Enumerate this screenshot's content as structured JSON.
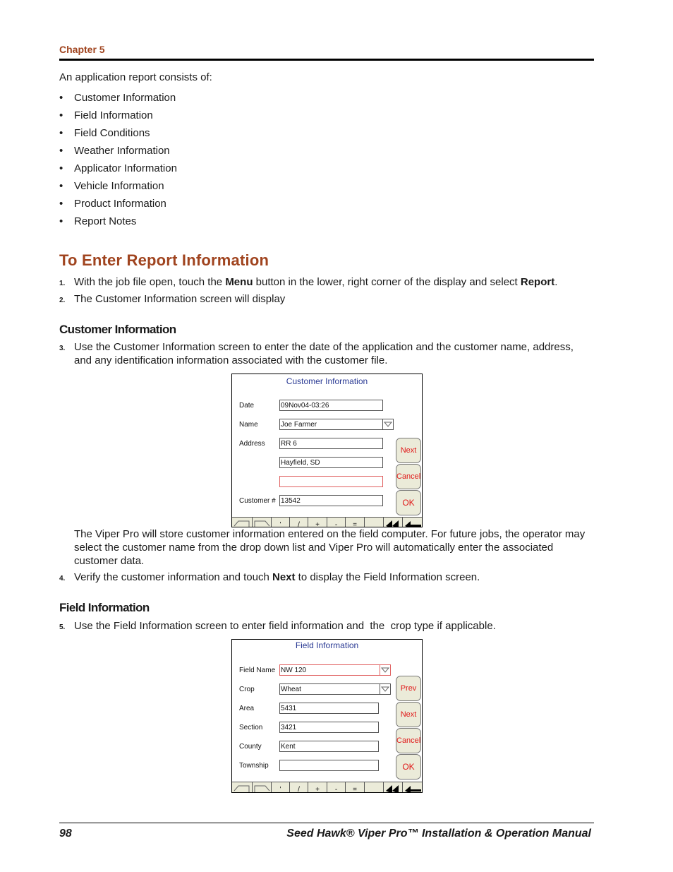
{
  "header": {
    "chapter": "Chapter 5"
  },
  "intro": "An application report consists of:",
  "report_parts": [
    "Customer Information",
    "Field Information",
    "Field Conditions",
    "Weather Information",
    "Applicator Information",
    "Vehicle Information",
    "Product Information",
    "Report Notes"
  ],
  "section_title": "To Enter Report Information",
  "steps": {
    "s1": {
      "num": "1.",
      "pre": "With the job file open, touch the ",
      "b1": "Menu",
      "mid": " button in the lower, right corner of the display and select ",
      "b2": "Report",
      "post": "."
    },
    "s2": {
      "num": "2.",
      "text": "The Customer Information screen will display"
    },
    "s3": {
      "num": "3.",
      "text": "Use the Customer Information screen to enter the date of the application and the customer name, address, and any identification information associated with the customer file."
    },
    "s3_note": "The Viper Pro will store customer information entered on the field computer. For future jobs, the operator may select the customer name from the drop down list and Viper Pro will automatically enter the associated customer data.",
    "s4": {
      "num": "4.",
      "pre": "Verify the customer information and touch ",
      "b1": "Next",
      "post": " to display the Field Information screen."
    },
    "s5": {
      "num": "5.",
      "text": "Use the Field Information screen to enter field information and  the  crop type if applicable."
    }
  },
  "subheadings": {
    "customer": "Customer Information",
    "field": "Field Information"
  },
  "customer_screen": {
    "title": "Customer Information",
    "labels": {
      "date": "Date",
      "name": "Name",
      "address": "Address",
      "customer_no": "Customer #"
    },
    "values": {
      "date": "09Nov04-03:26",
      "name": "Joe Farmer",
      "address1": "RR 6",
      "address2": "Hayfield, SD",
      "address3": "",
      "customer_no": "13542"
    },
    "buttons": {
      "next": "Next",
      "cancel": "Cancel",
      "ok": "OK"
    },
    "keys": [
      "'",
      "/",
      "+",
      "-",
      "=",
      ""
    ]
  },
  "field_screen": {
    "title": "Field Information",
    "labels": {
      "field_name": "Field Name",
      "crop": "Crop",
      "area": "Area",
      "section": "Section",
      "county": "County",
      "township": "Township"
    },
    "values": {
      "field_name": "NW 120",
      "crop": "Wheat",
      "area": "5431",
      "section": "3421",
      "county": "Kent",
      "township": ""
    },
    "buttons": {
      "prev": "Prev",
      "next": "Next",
      "cancel": "Cancel",
      "ok": "OK"
    },
    "keys": [
      "'",
      "/",
      "+",
      "-",
      "=",
      ""
    ]
  },
  "footer": {
    "page_number": "98",
    "manual_title": "Seed Hawk® Viper Pro™ Installation & Operation Manual"
  }
}
